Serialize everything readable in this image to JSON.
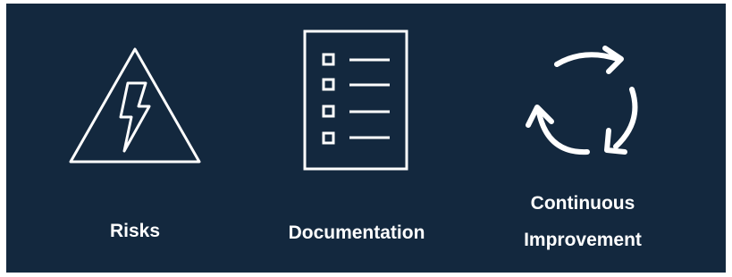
{
  "theme": {
    "background": "#13283e",
    "foreground": "#ffffff"
  },
  "items": [
    {
      "icon": "warning-lightning-icon",
      "label": "Risks"
    },
    {
      "icon": "checklist-document-icon",
      "label": "Documentation"
    },
    {
      "icon": "cycle-arrows-icon",
      "label_line1": "Continuous",
      "label_line2": "Improvement"
    }
  ]
}
